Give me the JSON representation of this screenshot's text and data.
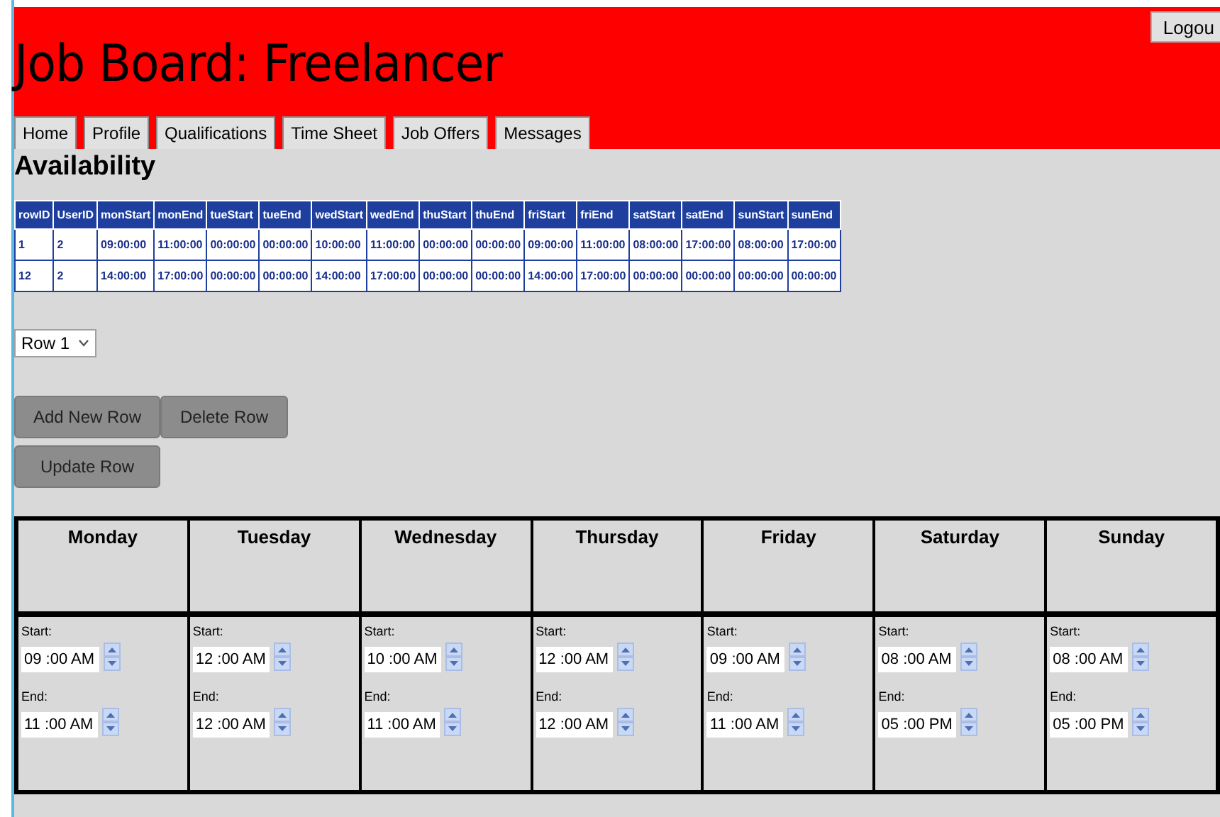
{
  "header": {
    "title": "Job Board: Freelancer",
    "logout": "Logou"
  },
  "nav": [
    {
      "label": "Home"
    },
    {
      "label": "Profile"
    },
    {
      "label": "Qualifications"
    },
    {
      "label": "Time Sheet"
    },
    {
      "label": "Job Offers"
    },
    {
      "label": "Messages"
    }
  ],
  "heading": "Availability",
  "table": {
    "columns": [
      "rowID",
      "UserID",
      "monStart",
      "monEnd",
      "tueStart",
      "tueEnd",
      "wedStart",
      "wedEnd",
      "thuStart",
      "thuEnd",
      "friStart",
      "friEnd",
      "satStart",
      "satEnd",
      "sunStart",
      "sunEnd"
    ],
    "rows": [
      [
        "1",
        "2",
        "09:00:00",
        "11:00:00",
        "00:00:00",
        "00:00:00",
        "10:00:00",
        "11:00:00",
        "00:00:00",
        "00:00:00",
        "09:00:00",
        "11:00:00",
        "08:00:00",
        "17:00:00",
        "08:00:00",
        "17:00:00"
      ],
      [
        "12",
        "2",
        "14:00:00",
        "17:00:00",
        "00:00:00",
        "00:00:00",
        "14:00:00",
        "17:00:00",
        "00:00:00",
        "00:00:00",
        "14:00:00",
        "17:00:00",
        "00:00:00",
        "00:00:00",
        "00:00:00",
        "00:00:00"
      ]
    ]
  },
  "row_select": {
    "value": "Row 1"
  },
  "buttons": [
    [
      "Add New Row",
      "Delete Row"
    ],
    [
      "Update Row"
    ]
  ],
  "days": [
    {
      "name": "Monday",
      "start_label": "Start:",
      "start": "09 :00 AM",
      "end_label": "End:",
      "end": "11 :00 AM"
    },
    {
      "name": "Tuesday",
      "start_label": "Start:",
      "start": "12 :00 AM",
      "end_label": "End:",
      "end": "12 :00 AM"
    },
    {
      "name": "Wednesday",
      "start_label": "Start:",
      "start": "10 :00 AM",
      "end_label": "End:",
      "end": "11 :00 AM"
    },
    {
      "name": "Thursday",
      "start_label": "Start:",
      "start": "12 :00 AM",
      "end_label": "End:",
      "end": "12 :00 AM"
    },
    {
      "name": "Friday",
      "start_label": "Start:",
      "start": "09 :00 AM",
      "end_label": "End:",
      "end": "11 :00 AM"
    },
    {
      "name": "Saturday",
      "start_label": "Start:",
      "start": "08 :00 AM",
      "end_label": "End:",
      "end": "05 :00 PM"
    },
    {
      "name": "Sunday",
      "start_label": "Start:",
      "start": "08 :00 AM",
      "end_label": "End:",
      "end": "05 :00 PM"
    }
  ]
}
